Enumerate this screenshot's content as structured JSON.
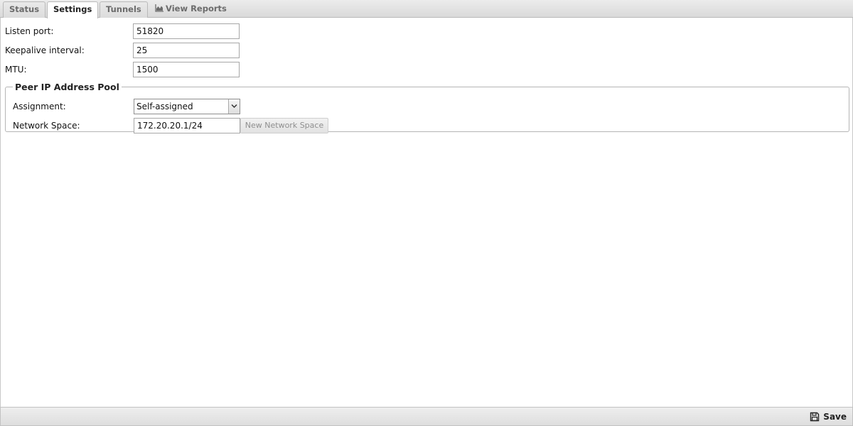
{
  "tabs": [
    {
      "label": "Status"
    },
    {
      "label": "Settings"
    },
    {
      "label": "Tunnels"
    },
    {
      "label": "View Reports",
      "icon": "area-chart-icon"
    }
  ],
  "active_tab": "Settings",
  "settings": {
    "listen_port": {
      "label": "Listen port:",
      "value": "51820"
    },
    "keepalive": {
      "label": "Keepalive interval:",
      "value": "25"
    },
    "mtu": {
      "label": "MTU:",
      "value": "1500"
    }
  },
  "pool": {
    "legend": "Peer IP Address Pool",
    "assignment": {
      "label": "Assignment:",
      "selected": "Self-assigned"
    },
    "network_space": {
      "label": "Network Space:",
      "value": "172.20.20.1/24",
      "button": "New Network Space"
    }
  },
  "footer": {
    "save_label": "Save",
    "save_icon": "floppy-disk-icon"
  }
}
